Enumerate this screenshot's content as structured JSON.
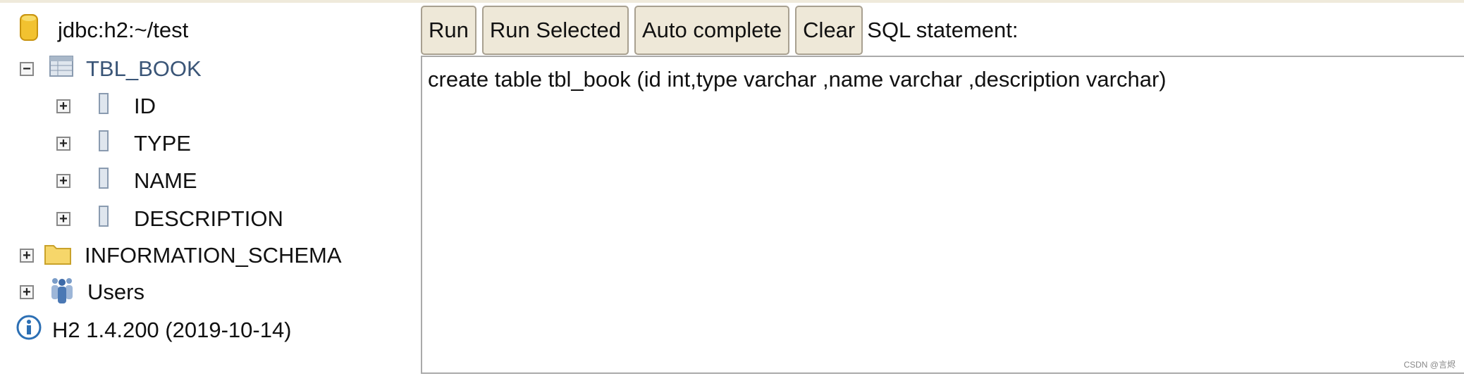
{
  "tree": {
    "connection": "jdbc:h2:~/test",
    "table": {
      "label": "TBL_BOOK",
      "expanded": true,
      "columns": [
        "ID",
        "TYPE",
        "NAME",
        "DESCRIPTION"
      ]
    },
    "schema": "INFORMATION_SCHEMA",
    "users": "Users",
    "version": "H2 1.4.200 (2019-10-14)"
  },
  "toolbar": {
    "run": "Run",
    "run_selected": "Run Selected",
    "auto_complete": "Auto complete",
    "clear": "Clear",
    "sql_label": "SQL statement:"
  },
  "editor": {
    "value": "create table tbl_book (id int,type varchar ,name varchar ,description varchar)"
  },
  "watermark": "CSDN @言烬"
}
